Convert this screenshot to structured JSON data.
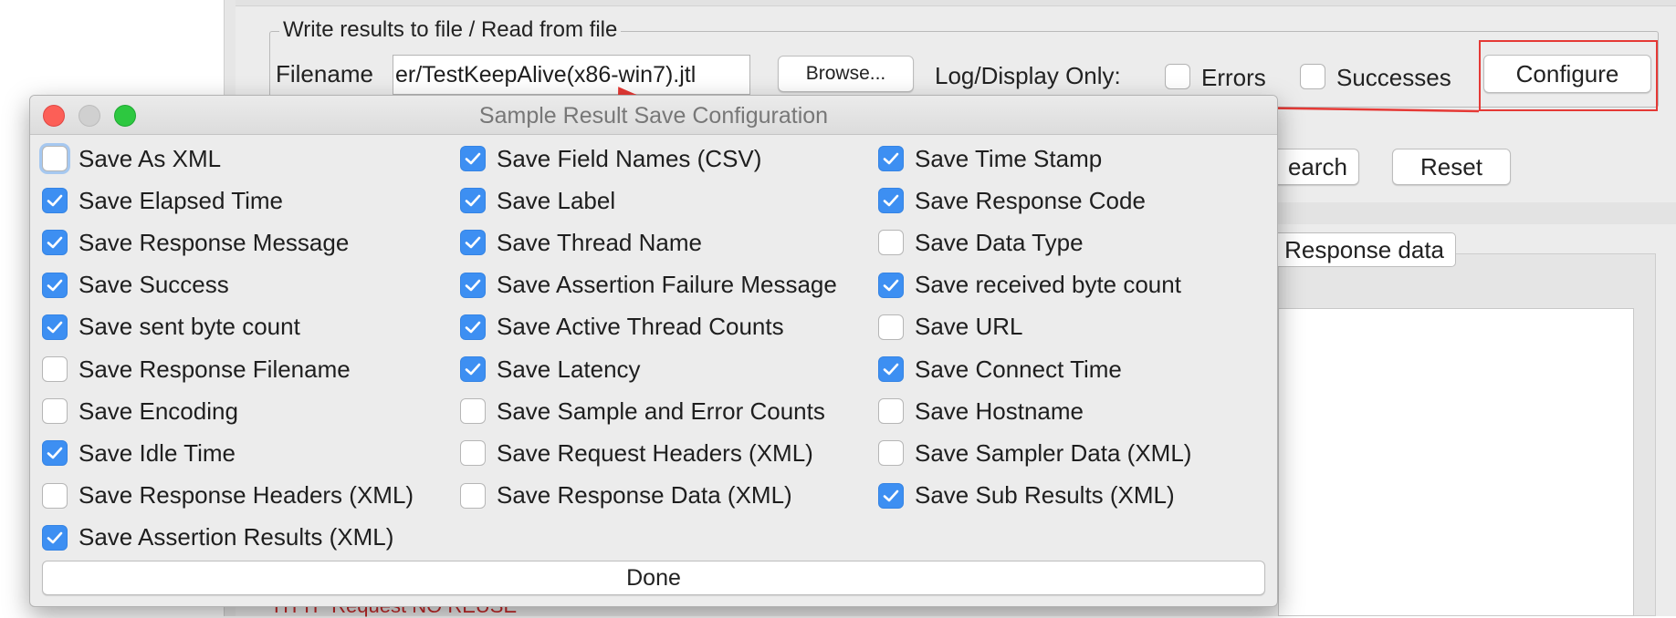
{
  "background": {
    "legend": "Write results to file / Read from file",
    "filename_label": "Filename",
    "filename_value": "er/TestKeepAlive(x86-win7).jtl",
    "browse_label": "Browse...",
    "log_display_label": "Log/Display Only:",
    "errors_label": "Errors",
    "successes_label": "Successes",
    "configure_label": "Configure",
    "search_label": "earch",
    "reset_label": "Reset",
    "response_tab_label": "Response data",
    "tree_fragment": "HTTP Request NO REUSE",
    "annotation_color": "#e53935"
  },
  "dialog": {
    "title": "Sample Result Save Configuration",
    "done_label": "Done",
    "accent_color": "#3d8ff2",
    "columns": [
      [
        {
          "label": "Save As XML",
          "checked": false
        },
        {
          "label": "Save Elapsed Time",
          "checked": true
        },
        {
          "label": "Save Response Message",
          "checked": true
        },
        {
          "label": "Save Success",
          "checked": true
        },
        {
          "label": "Save sent byte count",
          "checked": true
        },
        {
          "label": "Save Response Filename",
          "checked": false
        },
        {
          "label": "Save Encoding",
          "checked": false
        },
        {
          "label": "Save Idle Time",
          "checked": true
        },
        {
          "label": "Save Response Headers (XML)",
          "checked": false
        },
        {
          "label": "Save Assertion Results (XML)",
          "checked": true
        }
      ],
      [
        {
          "label": "Save Field Names (CSV)",
          "checked": true
        },
        {
          "label": "Save Label",
          "checked": true
        },
        {
          "label": "Save Thread Name",
          "checked": true
        },
        {
          "label": "Save Assertion Failure Message",
          "checked": true
        },
        {
          "label": "Save Active Thread Counts",
          "checked": true
        },
        {
          "label": "Save Latency",
          "checked": true
        },
        {
          "label": "Save Sample and Error Counts",
          "checked": false
        },
        {
          "label": "Save Request Headers (XML)",
          "checked": false
        },
        {
          "label": "Save Response Data (XML)",
          "checked": false
        }
      ],
      [
        {
          "label": "Save Time Stamp",
          "checked": true
        },
        {
          "label": "Save Response Code",
          "checked": true
        },
        {
          "label": "Save Data Type",
          "checked": false
        },
        {
          "label": "Save received byte count",
          "checked": true
        },
        {
          "label": "Save URL",
          "checked": false
        },
        {
          "label": "Save Connect Time",
          "checked": true
        },
        {
          "label": "Save Hostname",
          "checked": false
        },
        {
          "label": "Save Sampler Data (XML)",
          "checked": false
        },
        {
          "label": "Save Sub Results (XML)",
          "checked": true
        }
      ]
    ]
  }
}
